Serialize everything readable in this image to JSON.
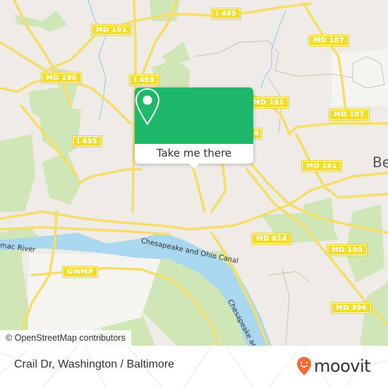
{
  "map": {
    "road_labels": [
      {
        "id": "md191-nw",
        "text": "MD 191"
      },
      {
        "id": "i495-n",
        "text": "I 495"
      },
      {
        "id": "md187-n",
        "text": "MD 187"
      },
      {
        "id": "md190-w",
        "text": "MD 190"
      },
      {
        "id": "i495-center",
        "text": "I 495"
      },
      {
        "id": "md191-center",
        "text": "MD 191"
      },
      {
        "id": "md187-e",
        "text": "MD 187"
      },
      {
        "id": "i495-w",
        "text": "I 495"
      },
      {
        "id": "md191-e",
        "text": "MD 191"
      },
      {
        "id": "md614",
        "text": "MD 614"
      },
      {
        "id": "md190-e",
        "text": "MD 190"
      },
      {
        "id": "md396",
        "text": "MD 396"
      },
      {
        "id": "gwmp",
        "text": "GWMP"
      },
      {
        "id": "partial-8",
        "text": "8"
      }
    ],
    "place_labels": [
      {
        "id": "bethesda-partial",
        "text": "Be"
      }
    ],
    "water_labels": [
      {
        "id": "potomac-river",
        "text": "mac River"
      },
      {
        "id": "canal-1",
        "text": "Chesapeake and Ohio Canal"
      },
      {
        "id": "canal-2",
        "text": "Chesapeake and Ohio C"
      }
    ],
    "attribution": "© OpenStreetMap contributors",
    "colors": {
      "land": "#efebe7",
      "park": "#cde6b4",
      "water": "#a9d7ef",
      "road": "#f6dd6a",
      "popup_green": "#1db86a",
      "moovit_orange": "#f26a36"
    }
  },
  "popup": {
    "icon": "location-pin-icon",
    "button_label": "Take me there"
  },
  "footer": {
    "address": "Crail Dr, Washington / Baltimore",
    "brand": "moovit"
  }
}
